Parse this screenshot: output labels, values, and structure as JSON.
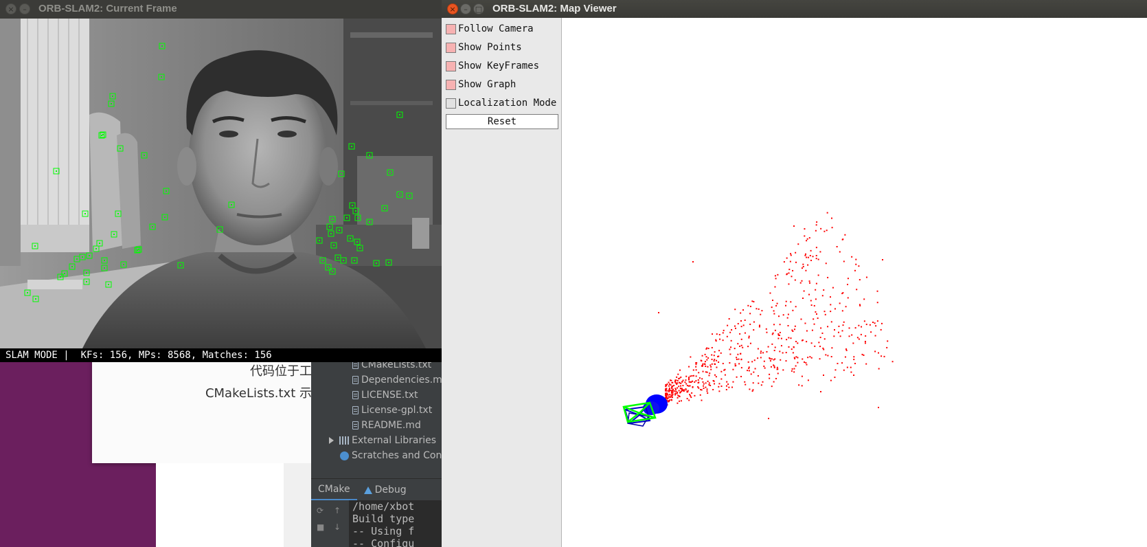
{
  "desktop": {
    "document_lines": [
      "代码位于工",
      "CMakeLists.txt 示"
    ]
  },
  "ide": {
    "tree_items": [
      {
        "label": "CMakeLists.txt",
        "icon": "file-icon"
      },
      {
        "label": "Dependencies.m",
        "icon": "file-icon"
      },
      {
        "label": "LICENSE.txt",
        "icon": "file-icon"
      },
      {
        "label": "License-gpl.txt",
        "icon": "file-icon"
      },
      {
        "label": "README.md",
        "icon": "file-icon"
      }
    ],
    "external_libraries": "External Libraries",
    "scratches": "Scratches and Cons",
    "tabs": {
      "cmake": "CMake",
      "debug": "Debug"
    },
    "console_lines": [
      "/home/xbot",
      "Build type",
      "-- Using f",
      "-- Configu"
    ]
  },
  "current_frame": {
    "title": "ORB-SLAM2: Current Frame",
    "status": "SLAM MODE |  KFs: 156, MPs: 8568, Matches: 156",
    "feature_color": "#00ff00"
  },
  "map_viewer": {
    "title": "ORB-SLAM2: Map Viewer",
    "options": [
      {
        "label": "Follow Camera",
        "checked": true
      },
      {
        "label": "Show Points",
        "checked": true
      },
      {
        "label": "Show KeyFrames",
        "checked": true
      },
      {
        "label": "Show Graph",
        "checked": true
      },
      {
        "label": "Localization Mode",
        "checked": false
      }
    ],
    "reset_label": "Reset",
    "map_point_color": "#ff0000",
    "keyframe_color": "#0000ff",
    "current_camera_color": "#00ff00"
  }
}
